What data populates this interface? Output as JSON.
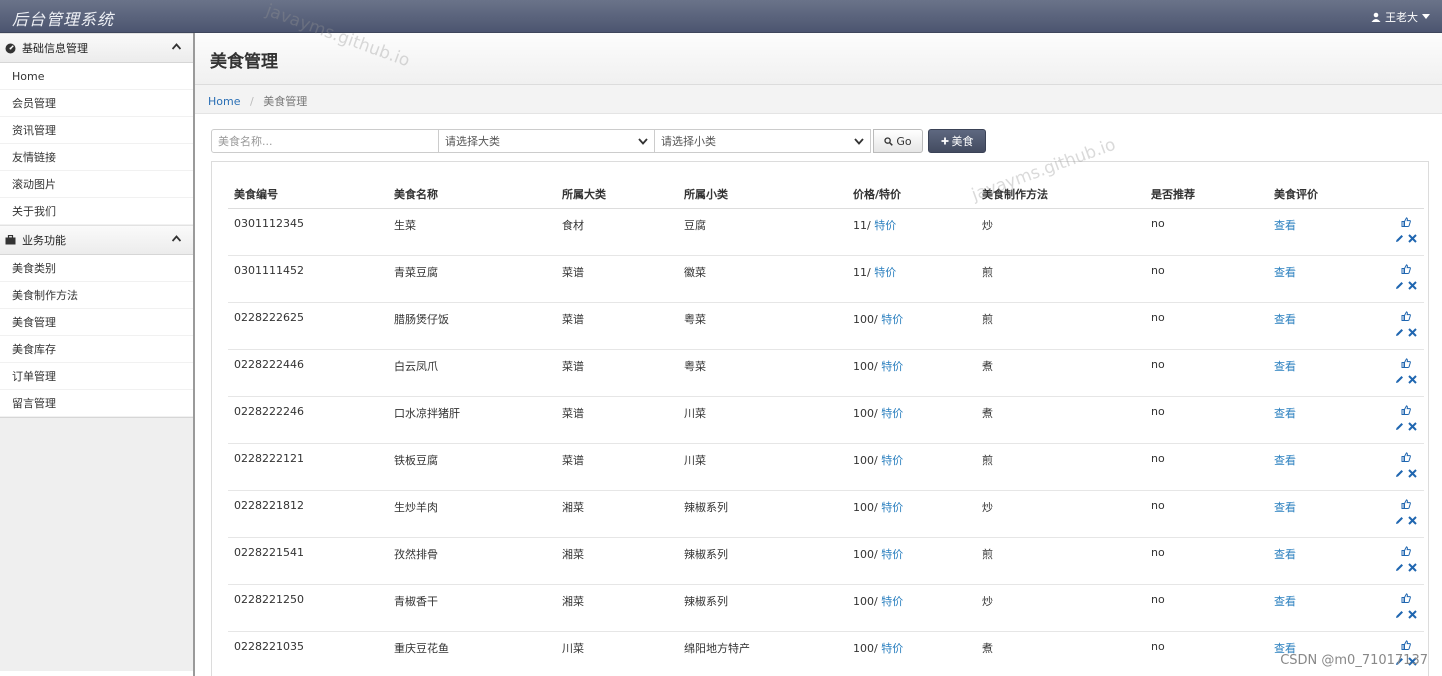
{
  "app": {
    "title": "后台管理系统",
    "user_name": "王老大"
  },
  "sidebar": {
    "sections": [
      {
        "title": "基础信息管理",
        "icon": "dashboard-icon",
        "items": [
          "Home",
          "会员管理",
          "资讯管理",
          "友情链接",
          "滚动图片",
          "关于我们"
        ]
      },
      {
        "title": "业务功能",
        "icon": "briefcase-icon",
        "items": [
          "美食类别",
          "美食制作方法",
          "美食管理",
          "美食库存",
          "订单管理",
          "留言管理"
        ]
      }
    ]
  },
  "page": {
    "title": "美食管理",
    "breadcrumb": {
      "home": "Home",
      "current": "美食管理"
    }
  },
  "search": {
    "placeholder": "美食名称...",
    "major_placeholder": "请选择大类",
    "minor_placeholder": "请选择小类",
    "go_label": "Go",
    "add_label": "美食"
  },
  "table": {
    "headers": [
      "美食编号",
      "美食名称",
      "所属大类",
      "所属小类",
      "价格/特价",
      "美食制作方法",
      "是否推荐",
      "美食评价"
    ],
    "special_label": "特价",
    "view_label": "查看",
    "rows": [
      {
        "id": "0301112345",
        "name": "生菜",
        "major": "食材",
        "minor": "豆腐",
        "price": "11/",
        "method": "炒",
        "recommend": "no"
      },
      {
        "id": "0301111452",
        "name": "青菜豆腐",
        "major": "菜谱",
        "minor": "徽菜",
        "price": "11/",
        "method": "煎",
        "recommend": "no"
      },
      {
        "id": "0228222625",
        "name": "腊肠煲仔饭",
        "major": "菜谱",
        "minor": "粤菜",
        "price": "100/",
        "method": "煎",
        "recommend": "no"
      },
      {
        "id": "0228222446",
        "name": "白云凤爪",
        "major": "菜谱",
        "minor": "粤菜",
        "price": "100/",
        "method": "煮",
        "recommend": "no"
      },
      {
        "id": "0228222246",
        "name": "口水凉拌猪肝",
        "major": "菜谱",
        "minor": "川菜",
        "price": "100/",
        "method": "煮",
        "recommend": "no"
      },
      {
        "id": "0228222121",
        "name": "铁板豆腐",
        "major": "菜谱",
        "minor": "川菜",
        "price": "100/",
        "method": "煎",
        "recommend": "no"
      },
      {
        "id": "0228221812",
        "name": "生炒羊肉",
        "major": "湘菜",
        "minor": "辣椒系列",
        "price": "100/",
        "method": "炒",
        "recommend": "no"
      },
      {
        "id": "0228221541",
        "name": "孜然排骨",
        "major": "湘菜",
        "minor": "辣椒系列",
        "price": "100/",
        "method": "煎",
        "recommend": "no"
      },
      {
        "id": "0228221250",
        "name": "青椒香干",
        "major": "湘菜",
        "minor": "辣椒系列",
        "price": "100/",
        "method": "炒",
        "recommend": "no"
      },
      {
        "id": "0228221035",
        "name": "重庆豆花鱼",
        "major": "川菜",
        "minor": "绵阳地方特产",
        "price": "100/",
        "method": "煮",
        "recommend": "no"
      }
    ]
  },
  "watermarks": [
    "javayms.github.io",
    "javayms.github.io"
  ],
  "footer_mark": "CSDN @m0_71017137",
  "colors": {
    "navbar": "#525b74",
    "link": "#2a7fbf",
    "add_button": "#4c5569"
  }
}
